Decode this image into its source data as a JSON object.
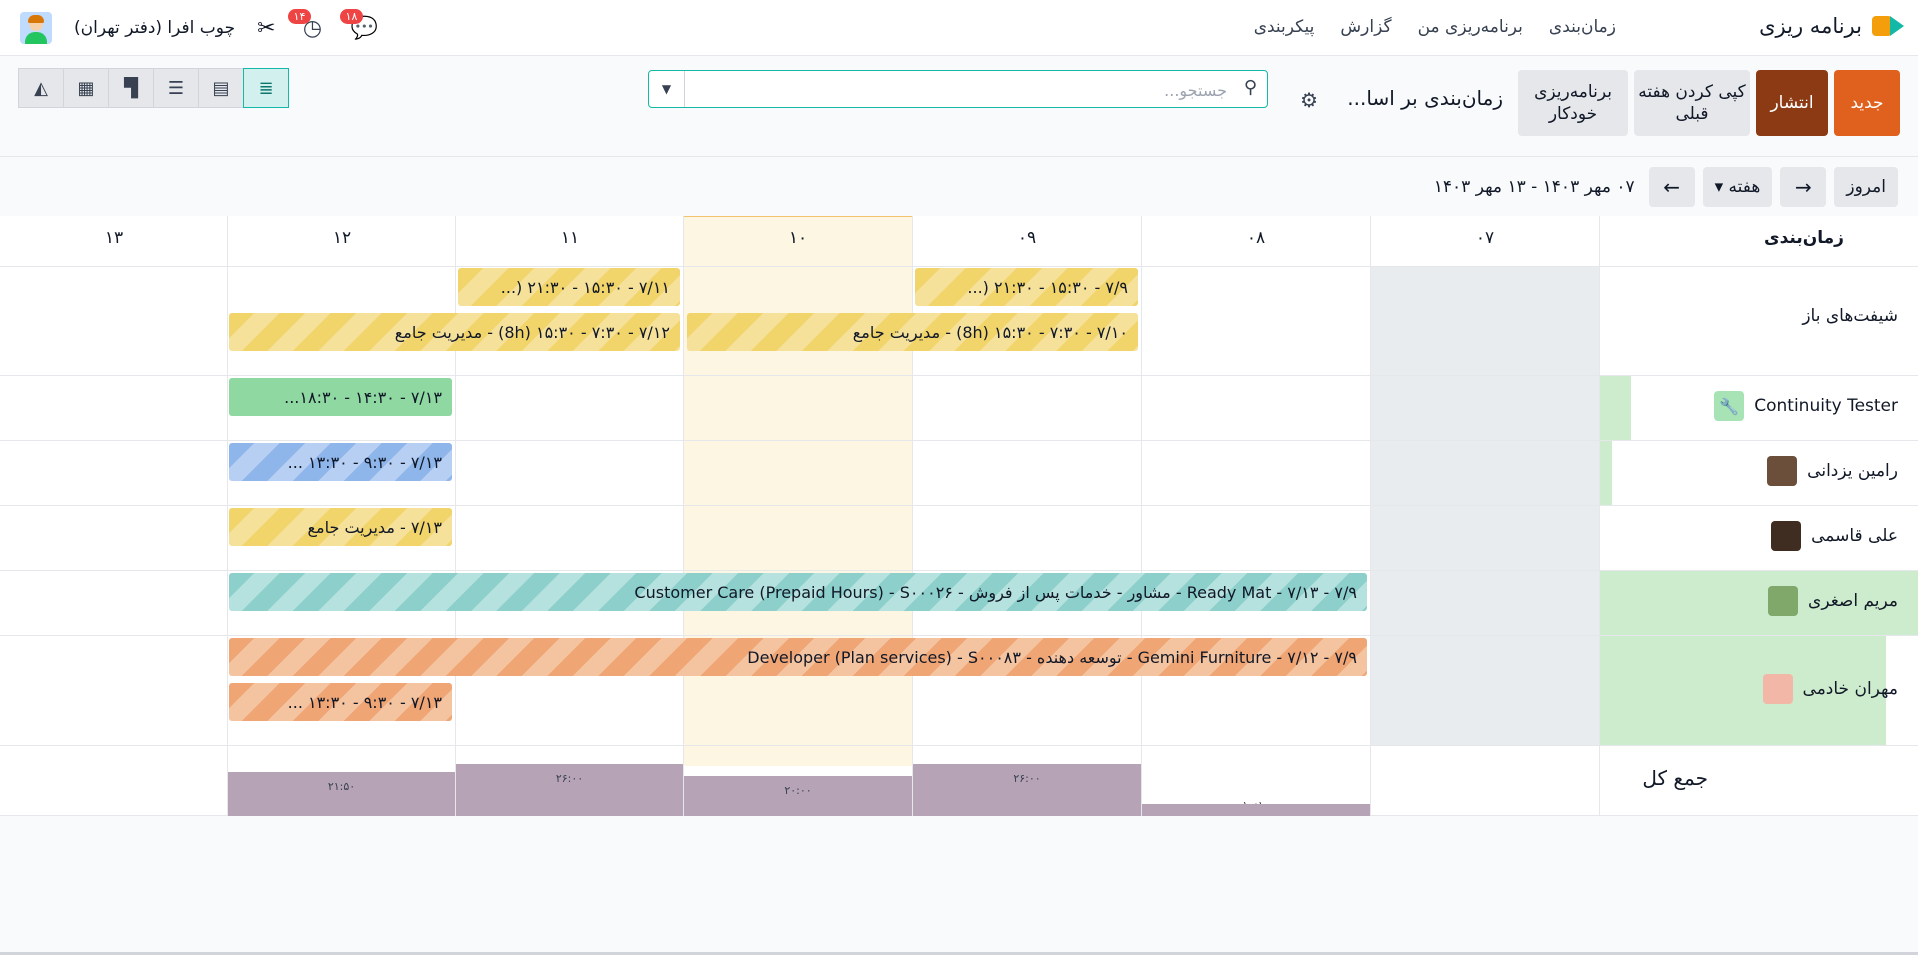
{
  "navbar": {
    "app_title": "برنامه ریزی",
    "menu": [
      "زمان‌بندی",
      "برنامه‌ریزی من",
      "گزارش",
      "پیکربندی"
    ],
    "company": "چوب افرا (دفتر تهران)",
    "messages_badge": "۱۸",
    "activities_badge": "۱۴"
  },
  "controls": {
    "new_label": "جدید",
    "publish_label": "انتشار",
    "copy_label": "کپی کردن هفته قبلی",
    "auto_label": "برنامه‌ریزی خودکار",
    "view_title": "زمان‌بندی بر اسا...",
    "search_placeholder": "جستجو..."
  },
  "subbar": {
    "today_label": "امروز",
    "scale_label": "هفته",
    "date_range": "۰۷ مهر ۱۴۰۳ - ۱۳ مهر ۱۴۰۳"
  },
  "gantt": {
    "header_title": "زمان‌بندی",
    "days": [
      "۰۷",
      "۰۸",
      "۰۹",
      "۱۰",
      "۱۱",
      "۱۲",
      "۱۳"
    ],
    "rows": {
      "open_shifts": "شیفت‌های باز",
      "continuity": "Continuity Tester",
      "ramin": "رامین یزدانی",
      "ali": "علی قاسمی",
      "maryam": "مریم اصغری",
      "mehran": "مهران خادمی",
      "total": "جمع کل"
    },
    "shifts": {
      "open_9": "۷/۹ - ۱۵:۳۰ - ۲۱:۳۰ (...",
      "open_11": "۷/۱۱ - ۱۵:۳۰ - ۲۱:۳۰ (...",
      "open_10": "۷/۱۰ - ۷:۳۰ - ۱۵:۳۰ (8h) - مدیریت جامع",
      "open_12": "۷/۱۲ - ۷:۳۰ - ۱۵:۳۰ (8h) - مدیریت جامع",
      "continuity_13": "۷/۱۳ - ۱۴:۳۰ - ۱۸:۳۰...",
      "ramin_13": "۷/۱۳ - ۹:۳۰ - ۱۳:۳۰ ...",
      "ali_13": "۷/۱۳ - مدیریت جامع",
      "maryam_range": "۷/۹ - ۷/۱۳ - Ready Mat - مشاور - خدمات پس از فروش - Customer Care (Prepaid Hours) - S۰۰۰۲۶",
      "mehran_range": "۷/۹ - ۷/۱۲ - Gemini Furniture - توسعه دهنده - Developer (Plan services) - S۰۰۰۸۳",
      "mehran_13": "۷/۱۳ - ۹:۳۰ - ۱۳:۳۰ ..."
    },
    "totals": [
      "۱۰:۱۰",
      "۲۶:۰۰",
      "۲۰:۰۰",
      "۲۶:۰۰",
      "۲۱:۵۰"
    ],
    "total_levels": [
      0.4,
      1.0,
      0.77,
      1.0,
      0.84
    ]
  },
  "colors": {
    "accent": "#14b8a6",
    "new_button": "#e0601e",
    "publish_button": "#8b3a14"
  }
}
